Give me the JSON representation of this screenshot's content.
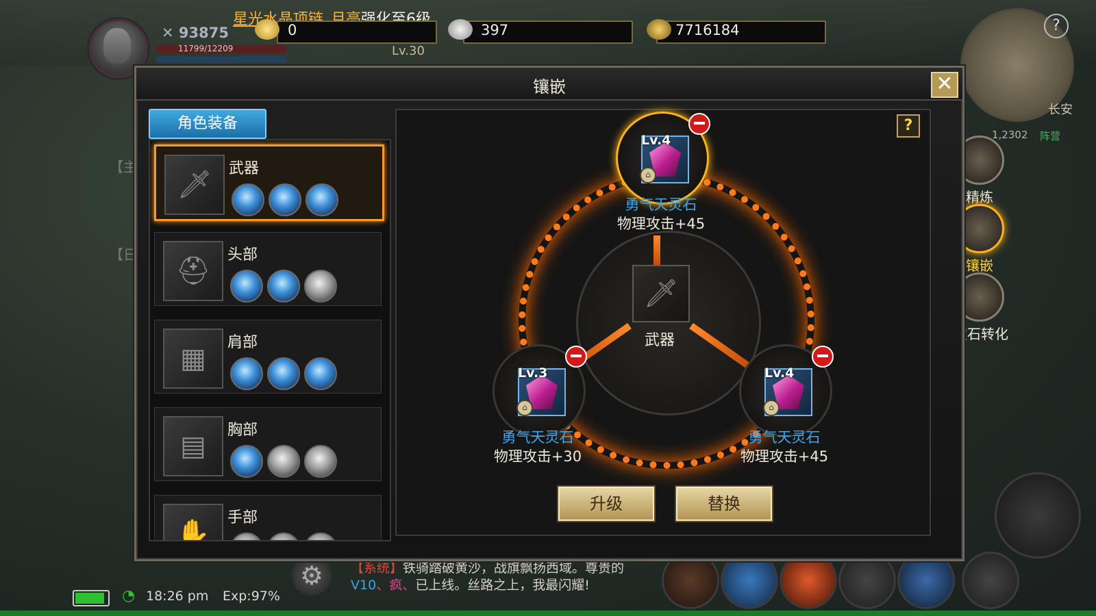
{
  "hud": {
    "announcement_item": "星光水晶项链_月亮",
    "announcement_suffix": "强化至6级",
    "combat_power": "93875",
    "hp_text": "11799/12209",
    "level": "Lv.30",
    "currencies": [
      {
        "icon": "gold-ingot-plus-icon",
        "value": "0"
      },
      {
        "icon": "silver-ingot-icon",
        "value": "397"
      },
      {
        "icon": "coin-icon",
        "value": "7716184"
      }
    ],
    "minimap_location": "长安",
    "coords": "1,2302",
    "faction": "阵营",
    "time": "18:26 pm",
    "exp": "Exp:97%",
    "chat": {
      "tag": "【系统】",
      "line1": "铁骑踏破黄沙，战旗飘扬西域。尊贵的",
      "vip": "V10",
      "name": "、疯、",
      "line2": "已上线。丝路之上，我最闪耀!"
    }
  },
  "modal": {
    "title": "镶嵌",
    "close_symbol": "✕",
    "tab_label": "角色装备",
    "equipment": [
      {
        "label": "武器",
        "icon": "sword-icon",
        "glyph": "🗡",
        "gems": [
          "blue",
          "blue",
          "blue"
        ],
        "selected": true
      },
      {
        "label": "头部",
        "icon": "helmet-icon",
        "glyph": "⛑",
        "gems": [
          "blue",
          "blue",
          "gray"
        ],
        "selected": false
      },
      {
        "label": "肩部",
        "icon": "shoulder-armor-icon",
        "glyph": "▦",
        "gems": [
          "blue",
          "blue",
          "blue"
        ],
        "selected": false
      },
      {
        "label": "胸部",
        "icon": "chest-armor-icon",
        "glyph": "▤",
        "gems": [
          "blue",
          "gray",
          "gray"
        ],
        "selected": false
      },
      {
        "label": "手部",
        "icon": "gauntlet-icon",
        "glyph": "✋",
        "gems": [
          "gray",
          "gray",
          "gray"
        ],
        "selected": false
      }
    ],
    "help_symbol": "?",
    "center_label": "武器",
    "gem_slots": [
      {
        "level": "Lv.4",
        "name": "勇气天灵石",
        "stat": "物理攻击+45"
      },
      {
        "level": "Lv.3",
        "name": "勇气天灵石",
        "stat": "物理攻击+30"
      },
      {
        "level": "Lv.4",
        "name": "勇气天灵石",
        "stat": "物理攻击+45"
      }
    ],
    "upgrade_label": "升级",
    "replace_label": "替换"
  },
  "side_tabs": [
    {
      "label": "精炼",
      "icon": "anvil-icon",
      "active": false
    },
    {
      "label": "镶嵌",
      "icon": "star-gem-icon",
      "active": true
    },
    {
      "label": "宝石转化",
      "icon": "convert-icon",
      "active": false
    }
  ],
  "colors": {
    "accent_orange": "#ff9a1c",
    "gem_name_blue": "#3ba7ee",
    "tab_blue": "#3fa9dd",
    "button_gold": "#e8d8a4"
  }
}
